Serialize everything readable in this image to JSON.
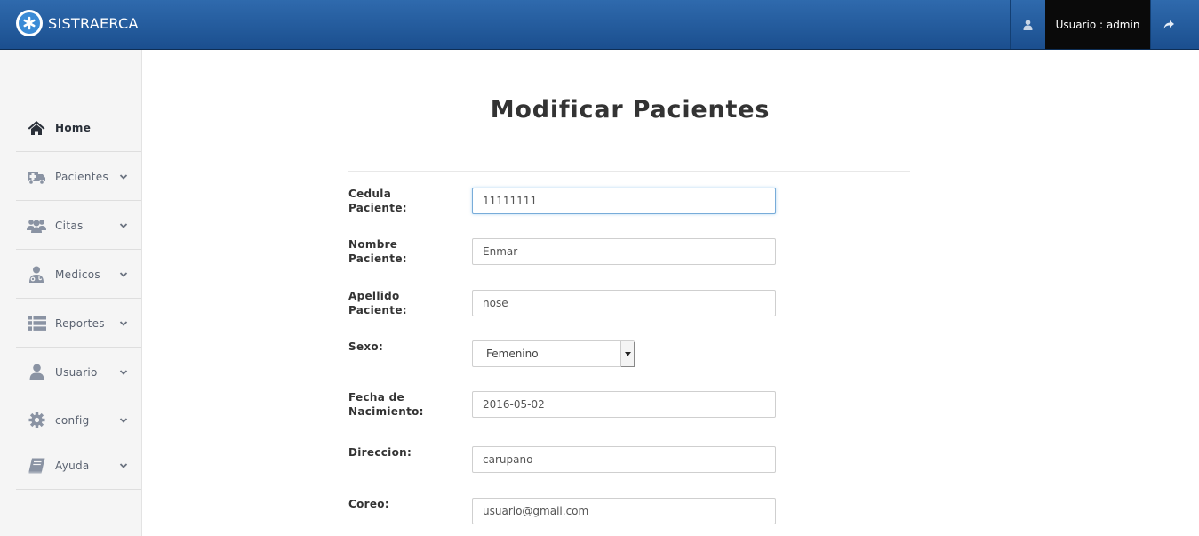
{
  "header": {
    "brand": "SISTRAERCA",
    "user_label": "Usuario : admin",
    "icons": {
      "logo": "medical-star-logo",
      "user": "user-icon",
      "logout": "share-arrow-icon"
    }
  },
  "sidebar": {
    "items": [
      {
        "label": "Home",
        "icon": "home-icon",
        "active": true
      },
      {
        "label": "Pacientes",
        "icon": "ambulance-icon"
      },
      {
        "label": "Citas",
        "icon": "users-icon"
      },
      {
        "label": "Medicos",
        "icon": "user-md-icon"
      },
      {
        "label": "Reportes",
        "icon": "list-icon"
      },
      {
        "label": "Usuario",
        "icon": "user-icon"
      },
      {
        "label": "config",
        "icon": "gear-icon"
      },
      {
        "label": "Ayuda",
        "icon": "book-icon"
      }
    ]
  },
  "main": {
    "title": "Modificar Pacientes",
    "fields": {
      "cedula": {
        "label": "Cedula Paciente:",
        "value": "11111111"
      },
      "nombre": {
        "label": "Nombre Paciente:",
        "value": "Enmar"
      },
      "apellido": {
        "label": "Apellido Paciente:",
        "value": "nose"
      },
      "sexo": {
        "label": "Sexo:",
        "value": "Femenino"
      },
      "fecha": {
        "label_line1": "Fecha de",
        "label_line2": "Nacimiento:",
        "value": "2016-05-02"
      },
      "direccion": {
        "label": "Direccion:",
        "value": "carupano"
      },
      "correo": {
        "label": "Coreo:",
        "value": "usuario@gmail.com"
      }
    }
  }
}
